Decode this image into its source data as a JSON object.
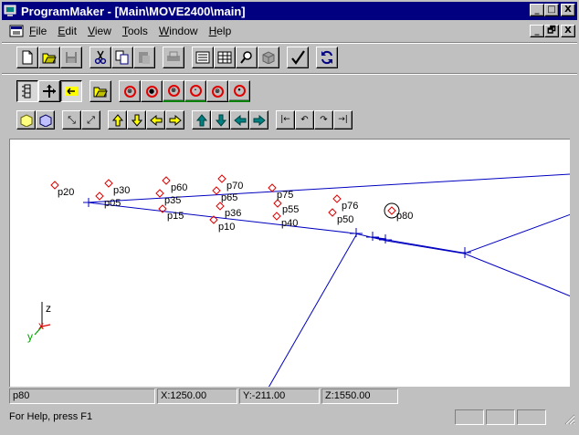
{
  "window": {
    "title": "ProgramMaker - [Main\\MOVE2400\\main]",
    "minimize_glyph": "_",
    "maximize_glyph": "□",
    "close_glyph": "X",
    "restore_glyph": "🗗"
  },
  "menu": {
    "items": [
      {
        "label_u": "F",
        "label_rest": "ile"
      },
      {
        "label_u": "E",
        "label_rest": "dit"
      },
      {
        "label_u": "V",
        "label_rest": "iew"
      },
      {
        "label_u": "T",
        "label_rest": "ools"
      },
      {
        "label_u": "W",
        "label_rest": "indow"
      },
      {
        "label_u": "H",
        "label_rest": "elp"
      }
    ]
  },
  "viewport": {
    "points": [
      {
        "label": "p20"
      },
      {
        "label": "p30"
      },
      {
        "label": "p60"
      },
      {
        "label": "p70"
      },
      {
        "label": "p75"
      },
      {
        "label": "p35"
      },
      {
        "label": "p65"
      },
      {
        "label": "p05"
      },
      {
        "label": "p76"
      },
      {
        "label": "p55"
      },
      {
        "label": "p36"
      },
      {
        "label": "p15"
      },
      {
        "label": "p50"
      },
      {
        "label": "p80"
      },
      {
        "label": "p40"
      },
      {
        "label": "p10"
      }
    ],
    "axis_labels": {
      "z": "z",
      "x": "x",
      "y": "y"
    },
    "colors": {
      "path": "#0000c0",
      "marker": "#e00000",
      "axis_z": "#000000",
      "axis_x": "#e00000",
      "axis_y": "#00a000"
    }
  },
  "coords": {
    "selected_point": "p80",
    "x": "X:1250.00",
    "y": "Y:-211.00",
    "z": "Z:1550.00"
  },
  "status": {
    "help_text": "For Help, press F1"
  }
}
